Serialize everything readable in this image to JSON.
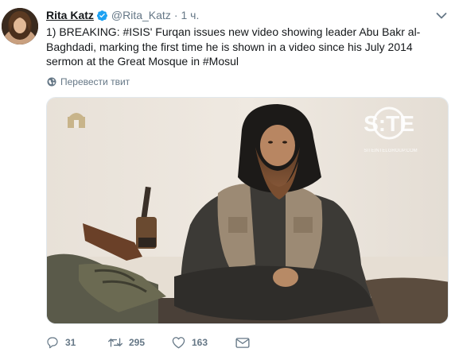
{
  "author": {
    "name": "Rita Katz",
    "handle": "@Rita_Katz",
    "separator": "·",
    "time": "1 ч."
  },
  "tweet": {
    "text": "1) BREAKING: #ISIS' Furqan issues new video showing leader Abu Bakr al-Baghdadi, marking the first time he is shown in a video since his July 2014 sermon at the Great Mosque in #Mosul",
    "translate_label": "Перевести твит"
  },
  "media": {
    "watermark_text": "S:TE",
    "watermark_url": "SITEINTELGROUP.COM"
  },
  "actions": {
    "reply_count": "31",
    "retweet_count": "295",
    "like_count": "163"
  },
  "colors": {
    "text": "#14171a",
    "muted": "#657786",
    "verified": "#1da1f2",
    "border": "#e1e8ed"
  },
  "icons": {
    "verified": "verified-badge-icon",
    "caret": "chevron-down-icon",
    "translate": "globe-icon",
    "reply": "reply-icon",
    "retweet": "retweet-icon",
    "like": "heart-icon",
    "dm": "direct-message-icon"
  }
}
